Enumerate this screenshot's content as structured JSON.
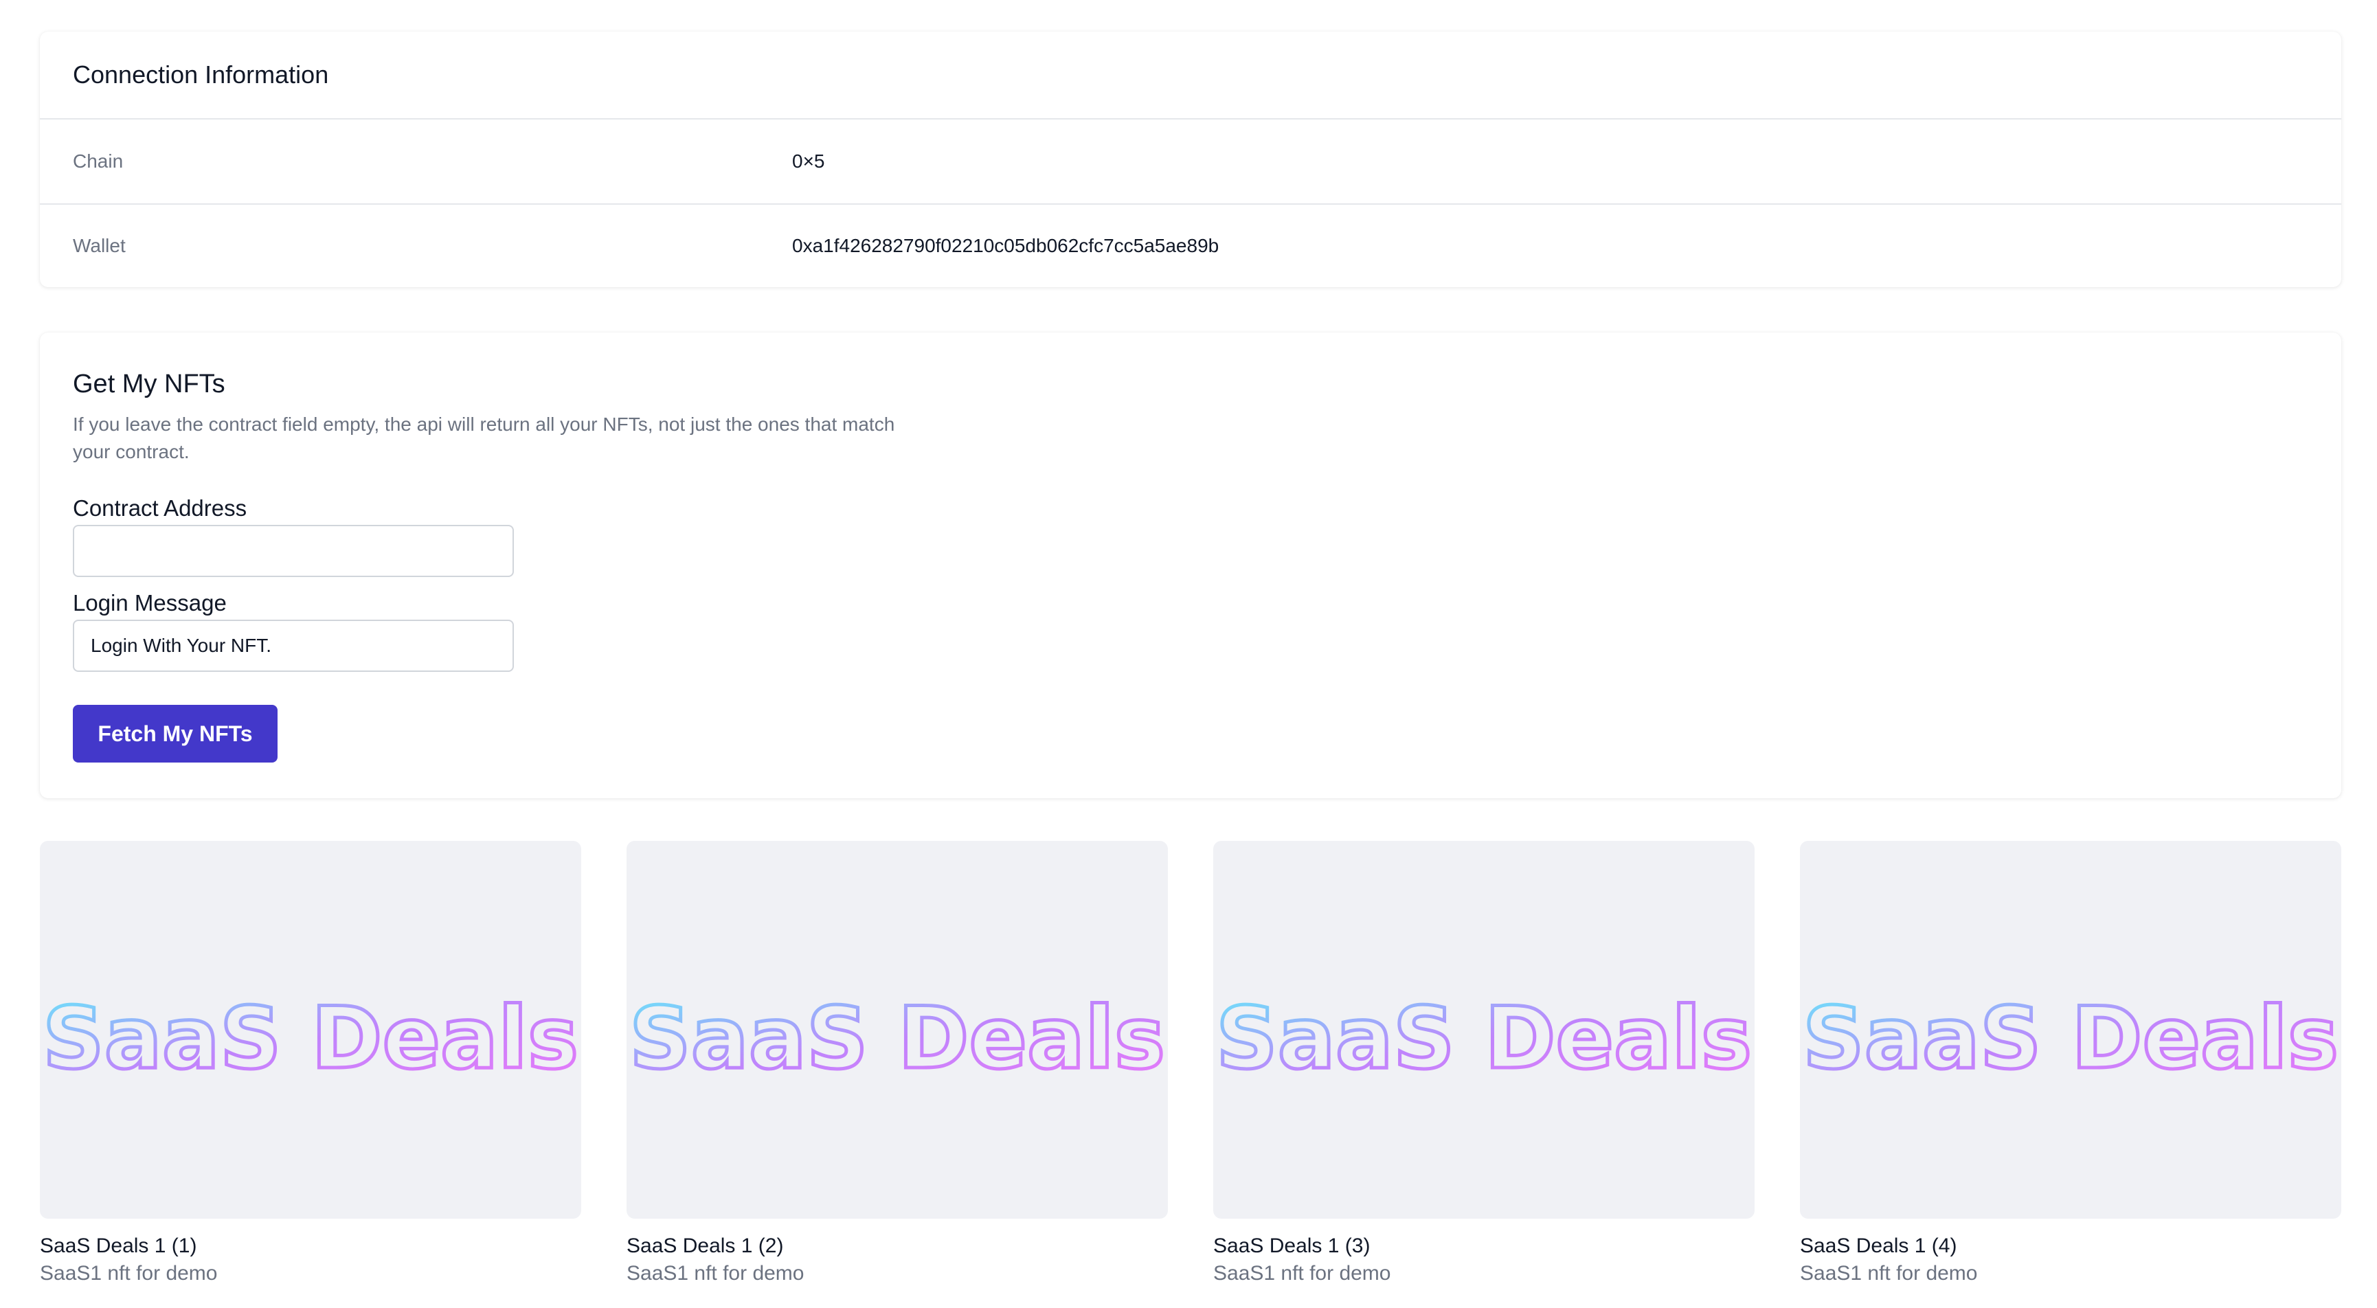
{
  "connection": {
    "title": "Connection Information",
    "rows": [
      {
        "label": "Chain",
        "value": "0×5"
      },
      {
        "label": "Wallet",
        "value": "0xa1f426282790f02210c05db062cfc7cc5a5ae89b"
      }
    ]
  },
  "nft_form": {
    "title": "Get My NFTs",
    "description": "If you leave the contract field empty, the api will return all your NFTs, not just the ones that match your contract.",
    "contract_label": "Contract Address",
    "contract_value": "",
    "login_label": "Login Message",
    "login_value": "Login With Your NFT.",
    "fetch_button": "Fetch My NFTs",
    "button_color": "#4338ca"
  },
  "nfts": [
    {
      "image_text": "SaaS Deals",
      "name": "SaaS Deals 1 (1)",
      "description": "SaaS1 nft for demo"
    },
    {
      "image_text": "SaaS Deals",
      "name": "SaaS Deals 1 (2)",
      "description": "SaaS1 nft for demo"
    },
    {
      "image_text": "SaaS Deals",
      "name": "SaaS Deals 1 (3)",
      "description": "SaaS1 nft for demo"
    },
    {
      "image_text": "SaaS Deals",
      "name": "SaaS Deals 1 (4)",
      "description": "SaaS1 nft for demo"
    }
  ]
}
